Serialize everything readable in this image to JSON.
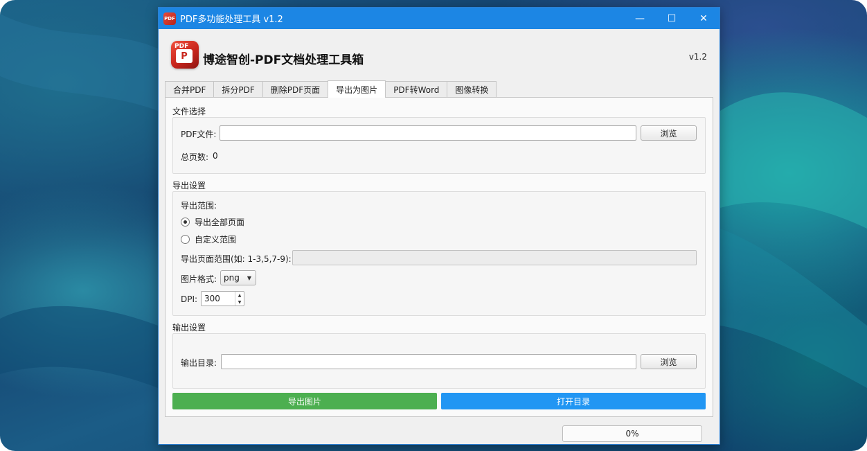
{
  "window": {
    "title": "PDF多功能处理工具 v1.2",
    "icon_text": "PDF",
    "controls": {
      "minimize": "—",
      "maximize": "☐",
      "close": "✕"
    }
  },
  "header": {
    "logo_tag": "PDF",
    "logo_glyph": "P",
    "title": "博途智创-PDF文档处理工具箱",
    "version": "v1.2"
  },
  "tabs": [
    {
      "label": "合并PDF",
      "active": false
    },
    {
      "label": "拆分PDF",
      "active": false
    },
    {
      "label": "删除PDF页面",
      "active": false
    },
    {
      "label": "导出为图片",
      "active": true
    },
    {
      "label": "PDF转Word",
      "active": false
    },
    {
      "label": "图像转换",
      "active": false
    }
  ],
  "file_section": {
    "title": "文件选择",
    "pdf_label": "PDF文件:",
    "pdf_value": "",
    "browse": "浏览",
    "pages_label": "总页数:",
    "pages_value": "0"
  },
  "export_section": {
    "title": "导出设置",
    "range_label": "导出范围:",
    "radio_all": "导出全部页面",
    "radio_custom": "自定义范围",
    "selected_range": "all",
    "page_range_label": "导出页面范围(如: 1-3,5,7-9):",
    "page_range_value": "",
    "format_label": "图片格式:",
    "format_value": "png",
    "dpi_label": "DPI:",
    "dpi_value": "300"
  },
  "output_section": {
    "title": "输出设置",
    "dir_label": "输出目录:",
    "dir_value": "",
    "browse": "浏览"
  },
  "actions": {
    "export": "导出图片",
    "open_dir": "打开目录",
    "export_color": "#4caf50",
    "open_color": "#2196f3"
  },
  "progress": {
    "text": "0%",
    "value": 0
  }
}
